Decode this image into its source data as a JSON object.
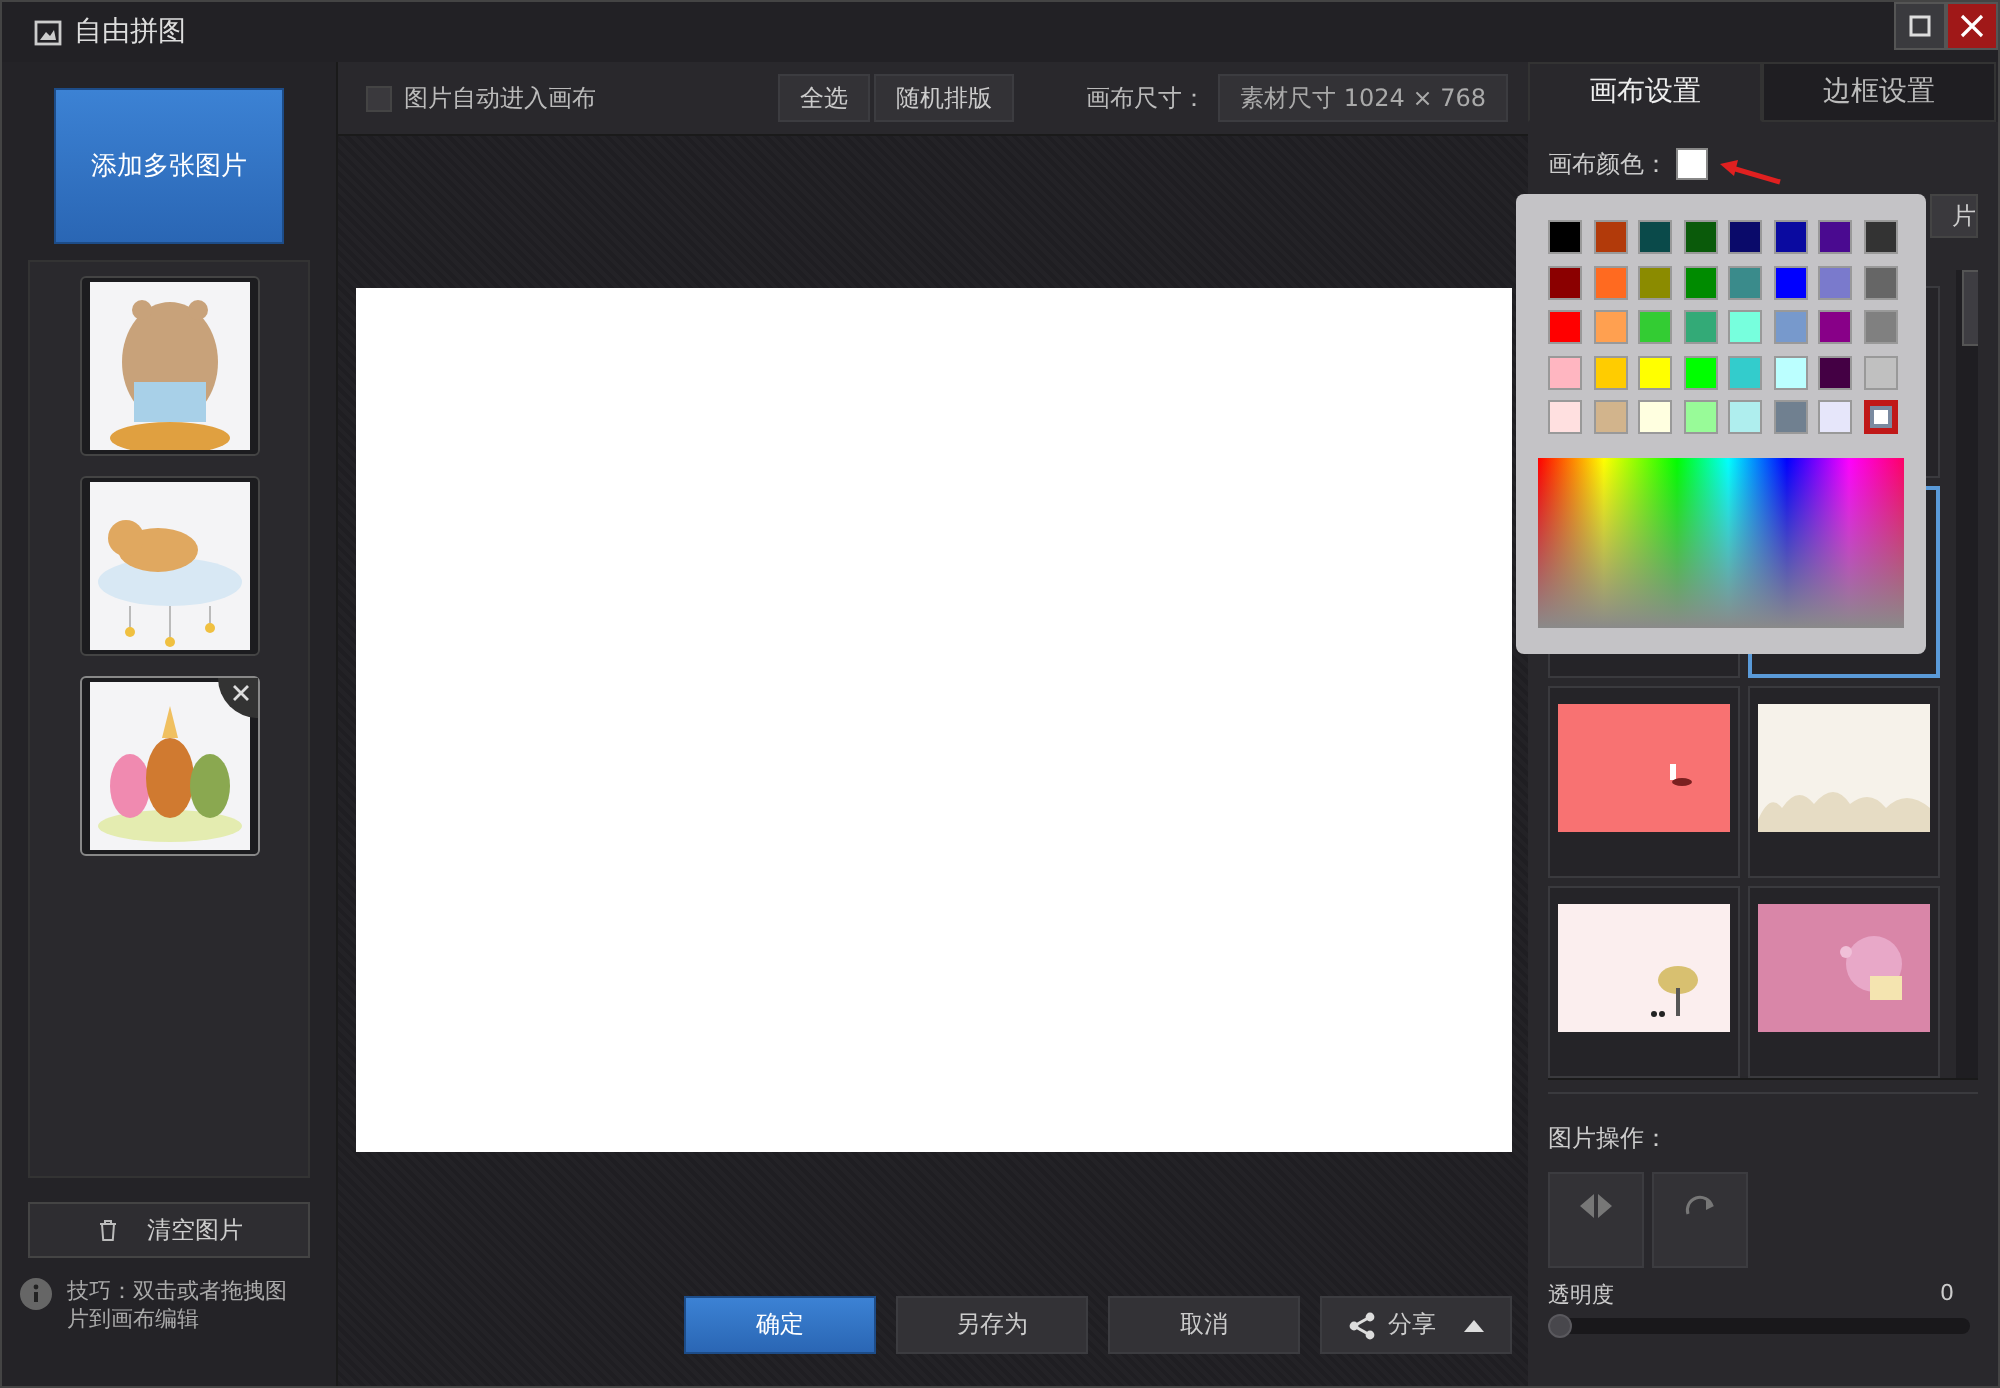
{
  "window": {
    "title": "自由拼图"
  },
  "left_panel": {
    "add_button": "添加多张图片",
    "thumbnails": [
      {
        "kind": "picture",
        "selected": false
      },
      {
        "kind": "picture",
        "selected": false
      },
      {
        "kind": "picture",
        "selected": true
      }
    ],
    "clear_button": "清空图片",
    "tip": "技巧：双击或者拖拽图片到画布编辑"
  },
  "toolbar": {
    "auto_checkbox": {
      "label": "图片自动进入画布",
      "checked": false
    },
    "buttons": [
      "全选",
      "随机排版"
    ],
    "canvas_size_label": "画布尺寸：",
    "canvas_size_value": "素材尺寸 1024 × 768"
  },
  "bottom_buttons": [
    {
      "label": "确定",
      "kind": "primary"
    },
    {
      "label": "另存为",
      "kind": "normal"
    },
    {
      "label": "取消",
      "kind": "normal"
    },
    {
      "label": "分享",
      "kind": "share"
    }
  ],
  "tabs": [
    {
      "label": "画布设置",
      "selected": true
    },
    {
      "label": "边框设置",
      "selected": false
    }
  ],
  "canvas_color_label": "画布颜色：",
  "hidden_button_fragment": "片",
  "color_popup": {
    "swatches": [
      {
        "color": "#000000",
        "selected": false
      },
      {
        "color": "#b23a0a",
        "selected": false
      },
      {
        "color": "#0a4a4a",
        "selected": false
      },
      {
        "color": "#0a5a0a",
        "selected": false
      },
      {
        "color": "#0a0a6a",
        "selected": false
      },
      {
        "color": "#0a0aa0",
        "selected": false
      },
      {
        "color": "#4a0a90",
        "selected": false
      },
      {
        "color": "#333333",
        "selected": false
      },
      {
        "color": "#8b0000",
        "selected": false
      },
      {
        "color": "#ff6a20",
        "selected": false
      },
      {
        "color": "#8b8b00",
        "selected": false
      },
      {
        "color": "#008b00",
        "selected": false
      },
      {
        "color": "#3a8b8b",
        "selected": false
      },
      {
        "color": "#0000ff",
        "selected": false
      },
      {
        "color": "#7a7acc",
        "selected": false
      },
      {
        "color": "#666666",
        "selected": false
      },
      {
        "color": "#ff0000",
        "selected": false
      },
      {
        "color": "#ffa050",
        "selected": false
      },
      {
        "color": "#33cc33",
        "selected": false
      },
      {
        "color": "#33aa77",
        "selected": false
      },
      {
        "color": "#77ffdd",
        "selected": false
      },
      {
        "color": "#7799cc",
        "selected": false
      },
      {
        "color": "#880088",
        "selected": false
      },
      {
        "color": "#808080",
        "selected": false
      },
      {
        "color": "#ffb6c1",
        "selected": false
      },
      {
        "color": "#ffcc00",
        "selected": false
      },
      {
        "color": "#ffff00",
        "selected": false
      },
      {
        "color": "#00ff00",
        "selected": false
      },
      {
        "color": "#33cccc",
        "selected": false
      },
      {
        "color": "#bbffff",
        "selected": false
      },
      {
        "color": "#440044",
        "selected": false
      },
      {
        "color": "#c0c0c0",
        "selected": false
      },
      {
        "color": "#ffe0e0",
        "selected": false
      },
      {
        "color": "#d2b48c",
        "selected": false
      },
      {
        "color": "#ffffe0",
        "selected": false
      },
      {
        "color": "#98fb98",
        "selected": false
      },
      {
        "color": "#afeeee",
        "selected": false
      },
      {
        "color": "#708090",
        "selected": false
      },
      {
        "color": "#e6e6fa",
        "selected": false
      },
      {
        "color": "#ffffff",
        "selected": true
      }
    ]
  },
  "templates": [
    {
      "kind": "blank",
      "selected": false
    },
    {
      "kind": "blank",
      "selected": false
    },
    {
      "kind": "blank",
      "selected": true
    },
    {
      "kind": "picture",
      "selected": false
    },
    {
      "kind": "picture",
      "selected": false
    },
    {
      "kind": "picture",
      "selected": false
    },
    {
      "kind": "picture",
      "selected": false
    }
  ],
  "image_ops_label": "图片操作：",
  "opacity": {
    "label": "透明度",
    "reading": "0",
    "level": 0
  }
}
